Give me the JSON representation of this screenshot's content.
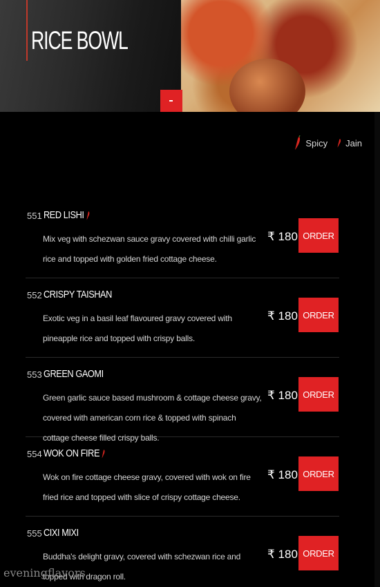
{
  "header": {
    "title": "RICE BOWL"
  },
  "legend": {
    "spicy": "Spicy",
    "jain": "Jain"
  },
  "items": [
    {
      "code": "551",
      "name": "RED LISHI",
      "spicy": true,
      "desc": "Mix veg with schezwan sauce gravy covered with chilli garlic rice and topped with golden fried cottage cheese.",
      "price": "₹ 180",
      "order": "ORDER"
    },
    {
      "code": "552",
      "name": "CRISPY TAISHAN",
      "spicy": false,
      "desc": "Exotic veg in a basil leaf flavoured gravy covered with pineapple rice and topped with crispy balls.",
      "price": "₹ 180",
      "order": "ORDER"
    },
    {
      "code": "553",
      "name": "GREEN GAOMI",
      "spicy": false,
      "desc": "Green garlic sauce based mushroom & cottage cheese gravy, covered with american corn rice & topped with spinach cottage cheese filled crispy balls.",
      "price": "₹ 180",
      "order": "ORDER"
    },
    {
      "code": "554",
      "name": "WOK ON FIRE",
      "spicy": true,
      "desc": "Wok on fire cottage cheese gravy, covered with wok on fire fried rice and topped with slice of crispy cottage cheese.",
      "price": "₹ 180",
      "order": "ORDER"
    },
    {
      "code": "555",
      "name": "CIXI MIXI",
      "spicy": false,
      "desc": "Buddha's delight gravy, covered with schezwan rice and topped with dragon roll.",
      "price": "₹ 180",
      "order": "ORDER"
    }
  ],
  "watermark": "eveningflavors",
  "colors": {
    "accent": "#e02224",
    "background": "#000000"
  }
}
